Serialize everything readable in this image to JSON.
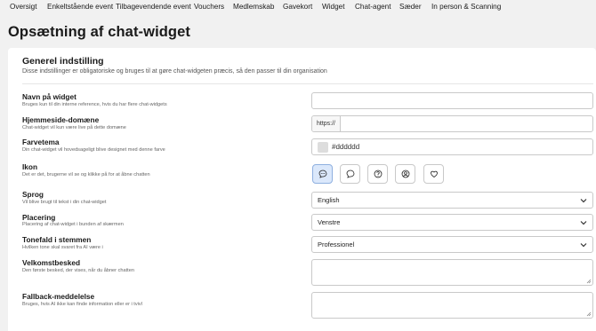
{
  "nav": {
    "tabs": [
      "Oversigt",
      "Enkeltstående event",
      "Tilbagevendende event",
      "Vouchers",
      "Medlemskab",
      "Gavekort",
      "Widget",
      "Chat-agent",
      "Sæder",
      "In person & Scanning"
    ]
  },
  "page": {
    "title": "Opsætning af chat-widget"
  },
  "section": {
    "title": "Generel indstilling",
    "description": "Disse indstillinger er obligatoriske og bruges til at gøre chat-widgeten præcis, så den passer til din organisation"
  },
  "fields": {
    "name": {
      "label": "Navn på widget",
      "help": "Bruges kun til din interne reference, hvis du har flere chat-widgets",
      "value": ""
    },
    "domain": {
      "label": "Hjemmeside-domæne",
      "help": "Chat-widget vil kun være live på dette domæne",
      "prefix": "https://",
      "value": ""
    },
    "color": {
      "label": "Farvetema",
      "help": "Din chat-widget vil hovedsageligt blive designet med denne farve",
      "value": "#dddddd",
      "swatch": "#dddddd"
    },
    "icon": {
      "label": "Ikon",
      "help": "Det er det, brugerne vil se og klikke på for at åbne chatten",
      "options": [
        "chat-dots-icon",
        "speech-bubble-icon",
        "question-circle-icon",
        "user-circle-icon",
        "heart-icon"
      ],
      "selected_index": 0
    },
    "language": {
      "label": "Sprog",
      "help": "Vil blive brugt til tekst i din chat-widget",
      "value": "English"
    },
    "placement": {
      "label": "Placering",
      "help": "Placering af chat-widget i bunden af skærmen",
      "value": "Venstre"
    },
    "tone": {
      "label": "Tonefald i stemmen",
      "help": "Hvilken tone skal svaret fra AI være i",
      "value": "Professionel"
    },
    "welcome": {
      "label": "Velkomstbesked",
      "help": "Den første besked, der vises, når du åbner chatten",
      "value": ""
    },
    "fallback": {
      "label": "Fallback-meddelelse",
      "help": "Bruges, hvis AI ikke kan finde information eller er i tvivl",
      "value": ""
    }
  },
  "colors": {
    "accent": "#dbe8fb",
    "accent_border": "#8fb0e0"
  }
}
